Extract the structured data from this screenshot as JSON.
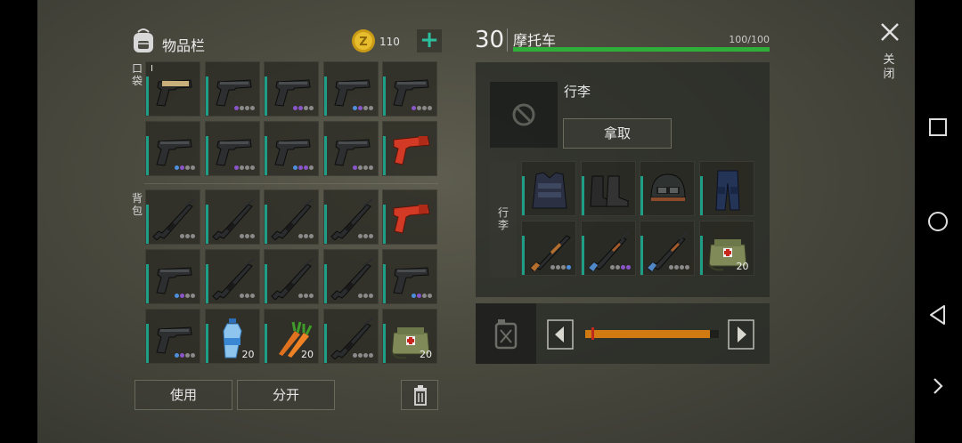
{
  "inventory": {
    "title": "物品栏",
    "coins": "110",
    "plus": "+",
    "pocket_label": "口袋",
    "backpack_label": "背包",
    "use_button": "使用",
    "split_button": "分开"
  },
  "pocket_slots": [
    {
      "item": "pistol-tan",
      "tier": "I",
      "dots": []
    },
    {
      "item": "pistol",
      "dots": [
        "p",
        "g",
        "g",
        "g"
      ]
    },
    {
      "item": "pistol",
      "dots": [
        "p",
        "p",
        "g",
        "g"
      ]
    },
    {
      "item": "pistol",
      "dots": [
        "b",
        "p",
        "g",
        "g"
      ]
    },
    {
      "item": "pistol",
      "dots": [
        "p",
        "g",
        "g",
        "g"
      ]
    },
    {
      "item": "pistol",
      "dots": [
        "b",
        "p",
        "g",
        "g"
      ]
    },
    {
      "item": "pistol",
      "dots": [
        "p",
        "g",
        "g",
        "g"
      ]
    },
    {
      "item": "pistol",
      "dots": [
        "b",
        "p",
        "p",
        "g"
      ]
    },
    {
      "item": "pistol",
      "dots": [
        "p",
        "g",
        "g",
        "g"
      ]
    },
    {
      "item": "flare-gun",
      "dots": []
    }
  ],
  "backpack_slots": [
    {
      "item": "rifle",
      "dots": [
        "g",
        "g",
        "g"
      ]
    },
    {
      "item": "rifle",
      "dots": [
        "g",
        "g",
        "g"
      ]
    },
    {
      "item": "rifle",
      "dots": [
        "g",
        "g",
        "g"
      ]
    },
    {
      "item": "rifle",
      "dots": [
        "g",
        "g",
        "g"
      ]
    },
    {
      "item": "flare-gun",
      "dots": []
    },
    {
      "item": "pistol",
      "dots": [
        "b",
        "p",
        "g",
        "g"
      ]
    },
    {
      "item": "rifle",
      "dots": [
        "g",
        "g",
        "g"
      ]
    },
    {
      "item": "rifle",
      "dots": [
        "g",
        "g",
        "g"
      ]
    },
    {
      "item": "rifle",
      "dots": [
        "g",
        "g",
        "g"
      ]
    },
    {
      "item": "pistol",
      "dots": [
        "b",
        "p",
        "g",
        "g"
      ]
    },
    {
      "item": "pistol",
      "dots": [
        "b",
        "p",
        "g",
        "g"
      ]
    },
    {
      "item": "water-bottle",
      "qty": "20",
      "dots": []
    },
    {
      "item": "carrots",
      "qty": "20",
      "dots": []
    },
    {
      "item": "rifle",
      "dots": [
        "g",
        "g",
        "g",
        "g"
      ]
    },
    {
      "item": "medkit-bag",
      "qty": "20",
      "dots": []
    }
  ],
  "vehicle": {
    "level": "30",
    "name": "摩托车",
    "hp_text": "100/100",
    "hp_fraction": 1.0,
    "item_title": "行李",
    "take_button": "拿取",
    "trunk_label": "行李",
    "fuel_fraction": 0.93
  },
  "trunk_slots": [
    {
      "item": "armor-vest",
      "dots": []
    },
    {
      "item": "boots",
      "dots": []
    },
    {
      "item": "helmet",
      "dots": []
    },
    {
      "item": "pants",
      "dots": []
    },
    {
      "item": "shotgun",
      "dots": [
        "g",
        "g",
        "g",
        "b"
      ]
    },
    {
      "item": "ak-rifle",
      "dots": [
        "g",
        "g",
        "p",
        "p"
      ]
    },
    {
      "item": "ak-rifle",
      "dots": [
        "g",
        "g",
        "g",
        "g"
      ]
    },
    {
      "item": "medkit-bag",
      "qty": "20",
      "dots": []
    }
  ],
  "close_label": "关闭",
  "colors": {
    "accent_teal": "#1e9e86",
    "hp_green": "#2faf3a",
    "fuel_orange": "#d17a12"
  }
}
